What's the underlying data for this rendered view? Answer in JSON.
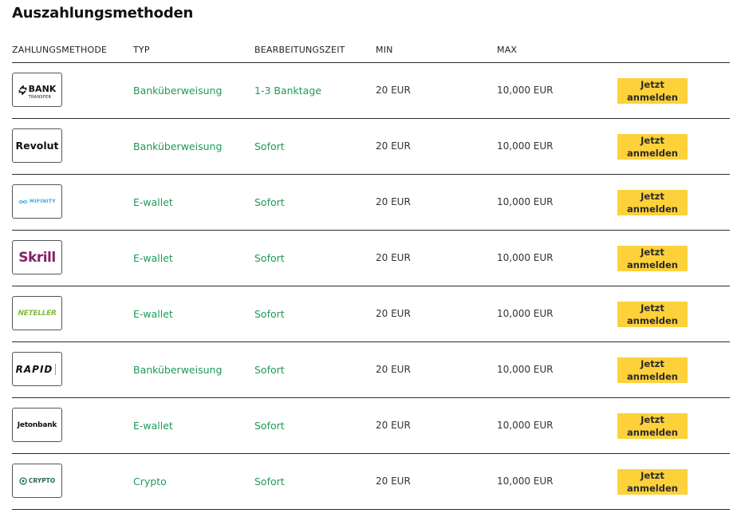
{
  "title": "Auszahlungsmethoden",
  "headers": [
    "ZAHLUNGSMETHODE",
    "TYP",
    "BEARBEITUNGSZEIT",
    "MIN",
    "MAX"
  ],
  "cta_label": "Jetzt\nanmelden",
  "colors": {
    "green": "#1e9a55",
    "button": "#fdd13a",
    "divider": "#2b2b2b"
  },
  "rows": [
    {
      "logo": "bank-transfer",
      "logo_main": "BANK",
      "logo_sub": "TRANSFER",
      "type": "Banküberweisung",
      "time": "1-3 Banktage",
      "min": "20 EUR",
      "max": "10,000 EUR"
    },
    {
      "logo": "revolut",
      "logo_main": "Revolut",
      "type": "Banküberweisung",
      "time": "Sofort",
      "min": "20 EUR",
      "max": "10,000 EUR"
    },
    {
      "logo": "mifinity",
      "logo_main": "MIFINITY",
      "type": "E-wallet",
      "time": "Sofort",
      "min": "20 EUR",
      "max": "10,000 EUR"
    },
    {
      "logo": "skrill",
      "logo_main": "Skrill",
      "type": "E-wallet",
      "time": "Sofort",
      "min": "20 EUR",
      "max": "10,000 EUR"
    },
    {
      "logo": "neteller",
      "logo_main": "NETELLER",
      "type": "E-wallet",
      "time": "Sofort",
      "min": "20 EUR",
      "max": "10,000 EUR"
    },
    {
      "logo": "rapid",
      "logo_main": "RAPID",
      "type": "Banküberweisung",
      "time": "Sofort",
      "min": "20 EUR",
      "max": "10,000 EUR"
    },
    {
      "logo": "jetonbank",
      "logo_main": "Jetonbank",
      "type": "E-wallet",
      "time": "Sofort",
      "min": "20 EUR",
      "max": "10,000 EUR"
    },
    {
      "logo": "crypto",
      "logo_main": "CRYPTO",
      "type": "Crypto",
      "time": "Sofort",
      "min": "20 EUR",
      "max": "10,000 EUR"
    }
  ]
}
